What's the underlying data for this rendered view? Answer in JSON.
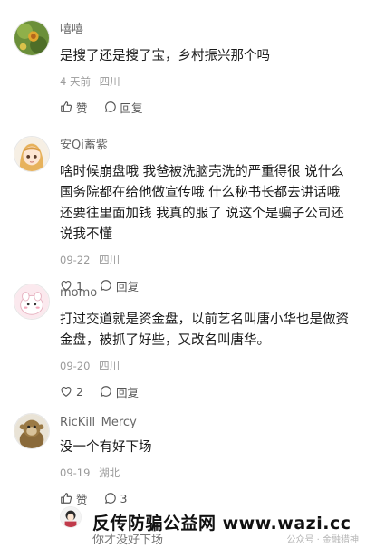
{
  "comments": [
    {
      "name": "嘻嘻",
      "text": "是搜了还是搜了宝，乡村振兴那个吗",
      "time": "4 天前",
      "location": "四川",
      "like_label": "赞",
      "reply_label": "回复",
      "avatar_icon": "flower-photo-avatar"
    },
    {
      "name": "安Qi蓄紫",
      "text": "啥时候崩盘哦 我爸被洗脑壳洗的严重得很 说什么国务院都在给他做宣传哦 什么秘书长都去讲话哦 还要往里面加钱 我真的服了 说这个是骗子公司还说我不懂",
      "time": "09-22",
      "location": "四川",
      "like_label": "1",
      "reply_label": "回复",
      "avatar_icon": "anime-girl-avatar"
    },
    {
      "name": "momo",
      "text": "打过交道就是资金盘，以前艺名叫唐小华也是做资金盘，被抓了好些，又改名叫唐华。",
      "time": "09-20",
      "location": "四川",
      "like_label": "2",
      "reply_label": "回复",
      "avatar_icon": "cute-blob-avatar"
    },
    {
      "name": "RicKill_Mercy",
      "text": "没一个有好下场",
      "time": "09-19",
      "location": "湖北",
      "like_label": "赞",
      "reply_label": "3",
      "avatar_icon": "monkey-photo-avatar"
    }
  ],
  "footer": {
    "watermark": "反传防骗公益网 www.wazi.cc",
    "sub_text": "你才没好下场",
    "small_mark": "公众号 · 金融猎神"
  }
}
